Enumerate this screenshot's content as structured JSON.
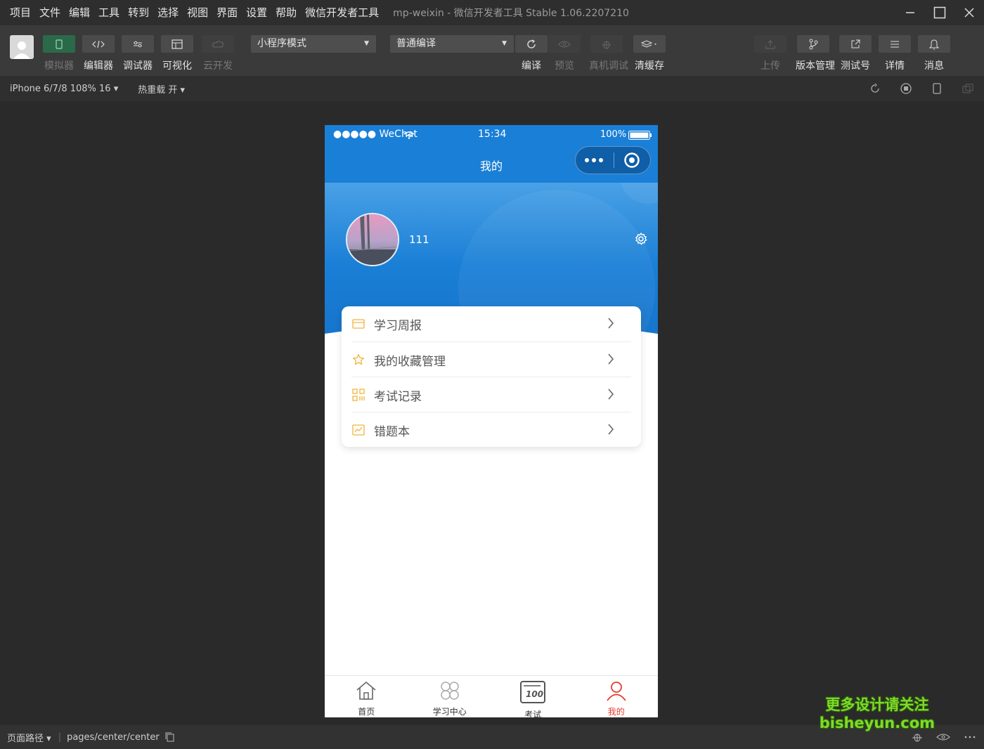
{
  "menu": [
    "项目",
    "文件",
    "编辑",
    "工具",
    "转到",
    "选择",
    "视图",
    "界面",
    "设置",
    "帮助",
    "微信开发者工具"
  ],
  "app_title": "mp-weixin - 微信开发者工具 Stable 1.06.2207210",
  "toolbar": {
    "simulator": "模拟器",
    "editor": "编辑器",
    "debugger": "调试器",
    "visual": "可视化",
    "cloud": "云开发",
    "mode_select": "小程序模式",
    "compile_select": "普通编译",
    "compile": "编译",
    "preview": "预览",
    "remote_debug": "真机调试",
    "clear_cache": "清缓存",
    "upload": "上传",
    "version": "版本管理",
    "test_account": "测试号",
    "details": "详情",
    "messages": "消息"
  },
  "subbar": {
    "device": "iPhone 6/7/8 108% 16",
    "hot_reload": "热重载 开"
  },
  "phone": {
    "carrier": "●●●●● WeChat",
    "time": "15:34",
    "battery": "100%",
    "nav_title": "我的",
    "user_name": "111",
    "menu_items": [
      {
        "label": "学习周报",
        "icon": "calendar-icon"
      },
      {
        "label": "我的收藏管理",
        "icon": "star-icon"
      },
      {
        "label": "考试记录",
        "icon": "grid-icon"
      },
      {
        "label": "错题本",
        "icon": "chart-icon"
      }
    ],
    "tabs": [
      {
        "label": "首页",
        "icon": "home-icon"
      },
      {
        "label": "学习中心",
        "icon": "clover-icon"
      },
      {
        "label": "考试",
        "icon": "exam-icon"
      },
      {
        "label": "我的",
        "icon": "user-icon"
      }
    ],
    "accent_color": "#1a7fd6",
    "active_tab_color": "#e43c2e",
    "menu_icon_color": "#f0b43c"
  },
  "bottombar": {
    "page_path_label": "页面路径",
    "page_path": "pages/center/center"
  },
  "watermark": {
    "line1": "更多设计请关注",
    "line2": "bisheyun.com"
  }
}
